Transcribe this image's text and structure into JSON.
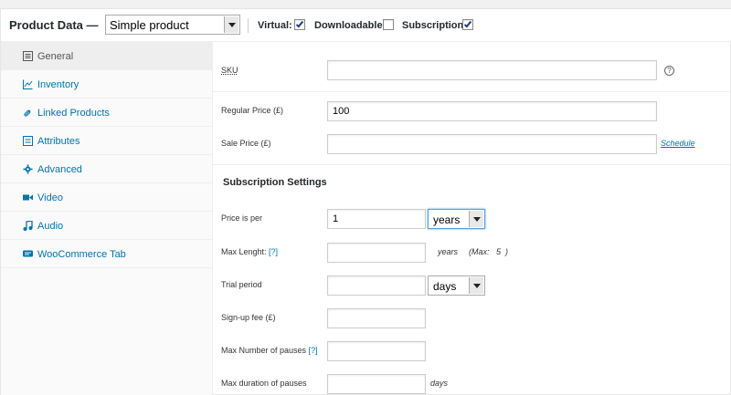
{
  "header": {
    "title": "Product Data —",
    "product_type": "Simple product",
    "virtual_label": "Virtual:",
    "virtual_checked": true,
    "downloadable_label": "Downloadable:",
    "downloadable_checked": false,
    "subscription_label": "Subscription:",
    "subscription_checked": true
  },
  "sidebar": {
    "items": [
      {
        "label": "General",
        "icon": "general-icon",
        "active": true
      },
      {
        "label": "Inventory",
        "icon": "inventory-icon"
      },
      {
        "label": "Linked Products",
        "icon": "link-icon"
      },
      {
        "label": "Attributes",
        "icon": "attributes-icon"
      },
      {
        "label": "Advanced",
        "icon": "gear-icon"
      },
      {
        "label": "Video",
        "icon": "video-icon"
      },
      {
        "label": "Audio",
        "icon": "audio-icon"
      },
      {
        "label": "WooCommerce Tab",
        "icon": "tab-icon"
      }
    ]
  },
  "form": {
    "sku_label": "SKU",
    "sku_value": "",
    "help_icon": "?",
    "regular_price_label": "Regular Price (£)",
    "regular_price_value": "100",
    "sale_price_label": "Sale Price (£)",
    "sale_price_value": "",
    "schedule_link": "Schedule",
    "subscription_title": "Subscription Settings",
    "price_per_label": "Price is per",
    "price_per_value": "1",
    "price_per_unit": "years",
    "max_length_label": "Max Lenght:",
    "max_length_help": "[?]",
    "max_length_value": "",
    "max_length_unit": "years",
    "max_length_max": "(Max:   5  )",
    "trial_label": "Trial period",
    "trial_value": "",
    "trial_unit": "days",
    "signup_label": "Sign-up fee (£)",
    "signup_value": "",
    "pauses_label": "Max Number of pauses",
    "pauses_help": "[?]",
    "pauses_value": "",
    "pause_duration_label": "Max duration of pauses",
    "pause_duration_value": "",
    "pause_duration_unit": "days"
  }
}
